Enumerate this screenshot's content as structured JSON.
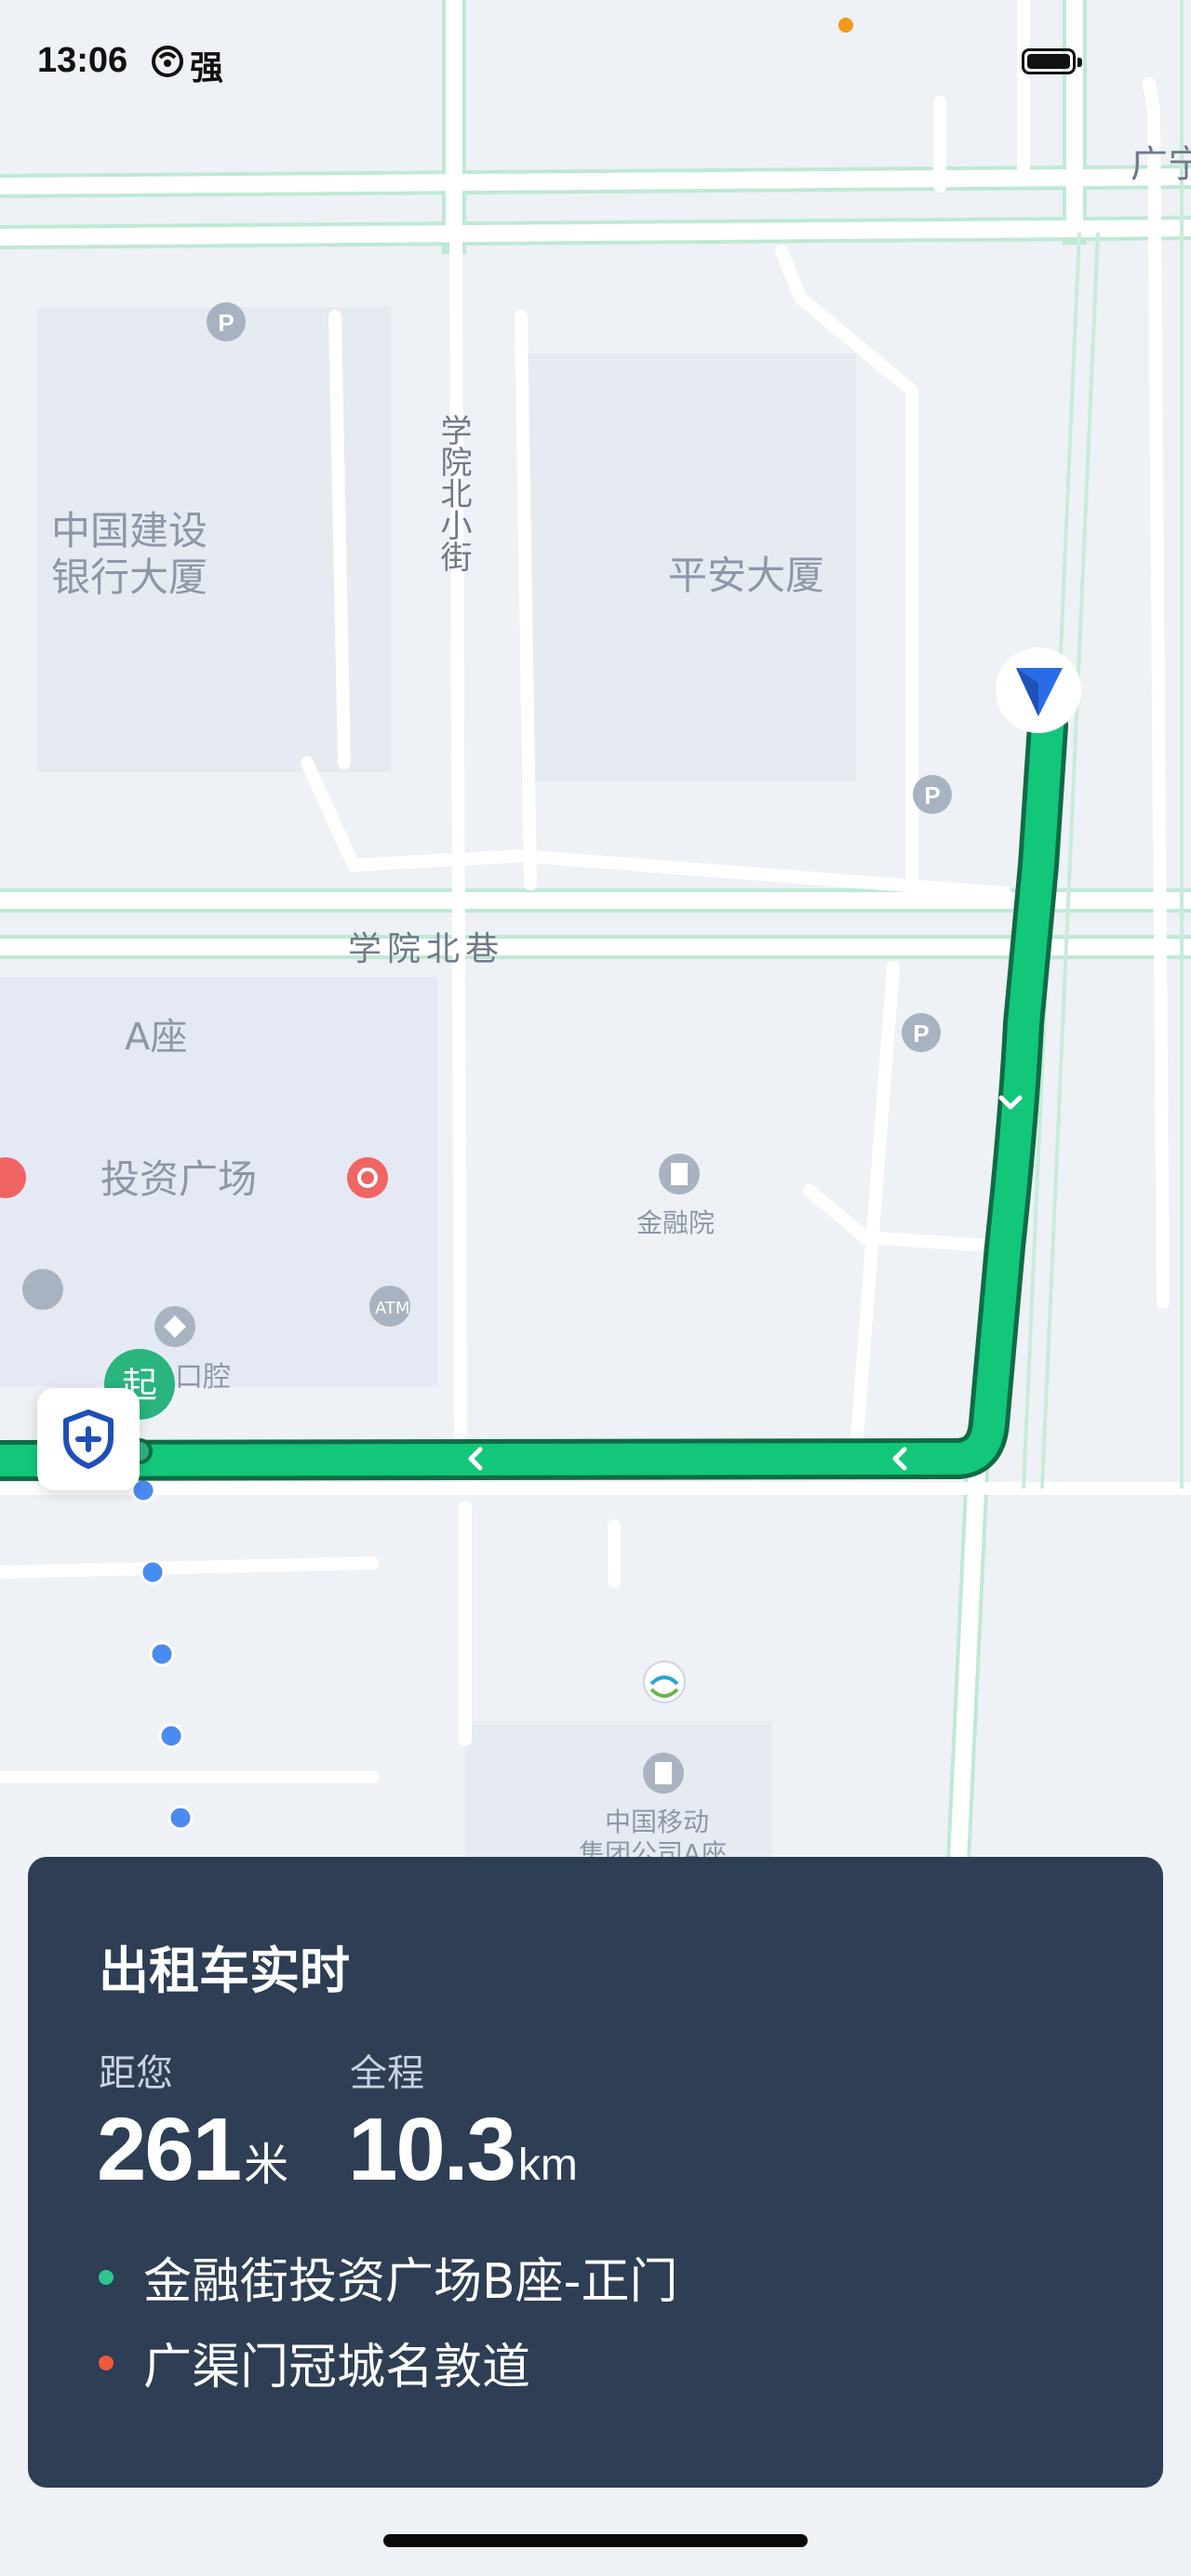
{
  "status_bar": {
    "time": "13:06",
    "carrier": "强"
  },
  "map": {
    "labels": {
      "ccb": [
        "中国建设",
        "银行大厦"
      ],
      "pingan": "平安大厦",
      "xueyuan_street": "学院北小街",
      "xueyuan_lane": "学院北巷",
      "tower_a": "A座",
      "investment_plaza": "投资广场",
      "financial_institute": "金融院",
      "dental": "口腔",
      "china_mobile": [
        "中国移动",
        "集团公司A座"
      ],
      "guang_partial": "广宁",
      "atm": "ATM"
    },
    "start_marker_label": "起",
    "colors": {
      "route": "#12c77a",
      "route_outline": "#0f6b45",
      "walk_dots": "#4a8bf0",
      "nav_arrow": "#2a6ce6"
    }
  },
  "card": {
    "title": "出租车实时",
    "distance_label": "距您",
    "distance_value": "261",
    "distance_unit": "米",
    "total_label": "全程",
    "total_value": "10.3",
    "total_unit": "km",
    "origin": "金融街投资广场B座-正门",
    "destination": "广渠门冠城名敦道",
    "origin_color": "#2ec58f",
    "destination_color": "#f0583a"
  }
}
